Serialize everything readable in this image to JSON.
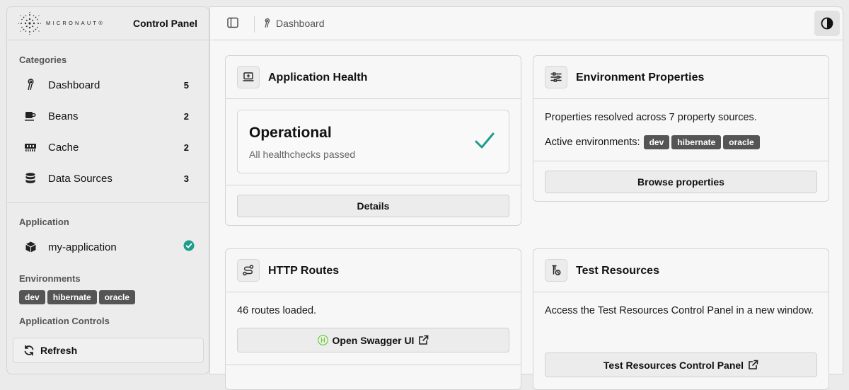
{
  "sidebar": {
    "logo_text": "MICRONAUT®",
    "title": "Control Panel",
    "categories_label": "Categories",
    "categories": [
      {
        "label": "Dashboard",
        "count": "5",
        "icon": "dashboard-icon"
      },
      {
        "label": "Beans",
        "count": "2",
        "icon": "coffee-cup-icon"
      },
      {
        "label": "Cache",
        "count": "2",
        "icon": "memory-chip-icon"
      },
      {
        "label": "Data Sources",
        "count": "3",
        "icon": "database-icon"
      }
    ],
    "application_label": "Application",
    "application_name": "my-application",
    "application_status_color": "#1e9c8c",
    "environments_label": "Environments",
    "environments": [
      "dev",
      "hibernate",
      "oracle"
    ],
    "controls_label": "Application Controls",
    "refresh_label": "Refresh"
  },
  "topbar": {
    "breadcrumb": "Dashboard"
  },
  "cards": {
    "health": {
      "title": "Application Health",
      "status": "Operational",
      "subtitle": "All healthchecks passed",
      "button": "Details",
      "check_color": "#1e9c8c"
    },
    "env": {
      "title": "Environment Properties",
      "text1": "Properties resolved across 7 property sources.",
      "active_label": "Active environments:",
      "environments": [
        "dev",
        "hibernate",
        "oracle"
      ],
      "button": "Browse properties"
    },
    "routes": {
      "title": "HTTP Routes",
      "text": "46 routes loaded.",
      "button": "Open Swagger UI"
    },
    "test": {
      "title": "Test Resources",
      "text": "Access the Test Resources Control Panel in a new window.",
      "button": "Test Resources Control Panel"
    }
  }
}
